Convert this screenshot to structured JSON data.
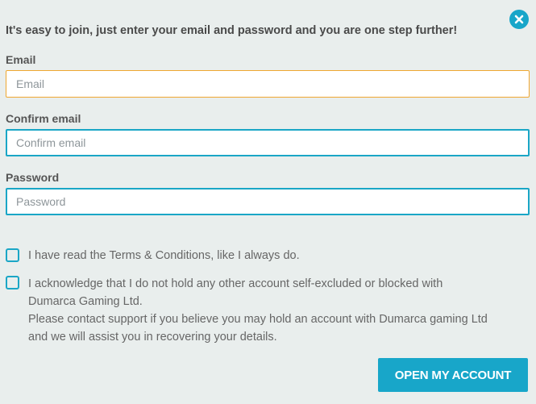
{
  "intro": "It's easy to join, just enter your email and password and you are one step further!",
  "fields": {
    "email": {
      "label": "Email",
      "placeholder": "Email",
      "value": ""
    },
    "confirm_email": {
      "label": "Confirm email",
      "placeholder": "Confirm email",
      "value": ""
    },
    "password": {
      "label": "Password",
      "placeholder": "Password",
      "value": ""
    }
  },
  "checkboxes": [
    {
      "lines": [
        "I have read the Terms & Conditions, like I always do."
      ],
      "checked": false
    },
    {
      "lines": [
        "I acknowledge that I do not hold any other account self-excluded or blocked with",
        "Dumarca Gaming Ltd.",
        "Please contact support if you believe you may hold an account with Dumarca gaming Ltd",
        "and we will assist you in recovering your details."
      ],
      "checked": false
    }
  ],
  "submit_label": "OPEN MY ACCOUNT",
  "icons": {
    "close": "close-icon"
  },
  "colors": {
    "accent": "#18a6c9",
    "focus_border": "#efa731",
    "background": "#e9eeed"
  }
}
